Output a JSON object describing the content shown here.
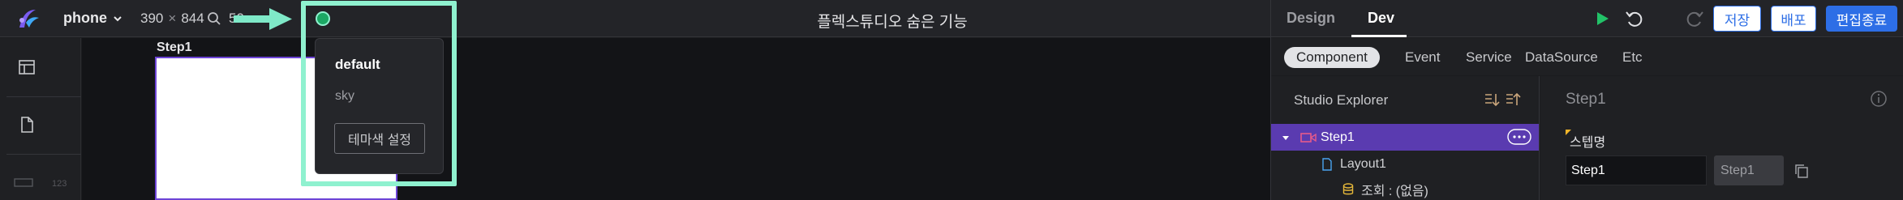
{
  "topbar": {
    "device": "phone",
    "width_value": "390",
    "times_sign": "×",
    "height_value": "844",
    "zoom_value": "50",
    "title": "플렉스튜디오 숨은 기능",
    "mode_tabs": [
      "Design",
      "Dev"
    ],
    "active_mode": "Dev",
    "buttons": {
      "save": "저장",
      "deploy": "배포",
      "exit": "편집종료"
    }
  },
  "canvas": {
    "step_label": "Step1"
  },
  "theme_popup": {
    "items": [
      "default",
      "sky"
    ],
    "selected": "default",
    "settings_button": "테마색 설정"
  },
  "right_panel": {
    "tabs": [
      "Component",
      "Event",
      "Service",
      "DataSource",
      "Etc"
    ],
    "active_tab": "Component",
    "explorer": {
      "title": "Studio Explorer",
      "tree": [
        {
          "label": "Step1",
          "icon": "step-icon",
          "selected": true
        },
        {
          "label": "Layout1",
          "icon": "file-icon",
          "selected": false
        },
        {
          "label": "조회 : (없음)",
          "icon": "database-icon",
          "selected": false
        }
      ]
    },
    "properties": {
      "title": "Step1",
      "field_label": "스텝명",
      "field_value": "Step1",
      "readonly_value": "Step1"
    }
  },
  "colors": {
    "accent_purple": "#5a3bb0",
    "highlight_mint": "#8ff1cf",
    "primary_blue": "#2d6ee6",
    "play_green": "#1ba864"
  }
}
